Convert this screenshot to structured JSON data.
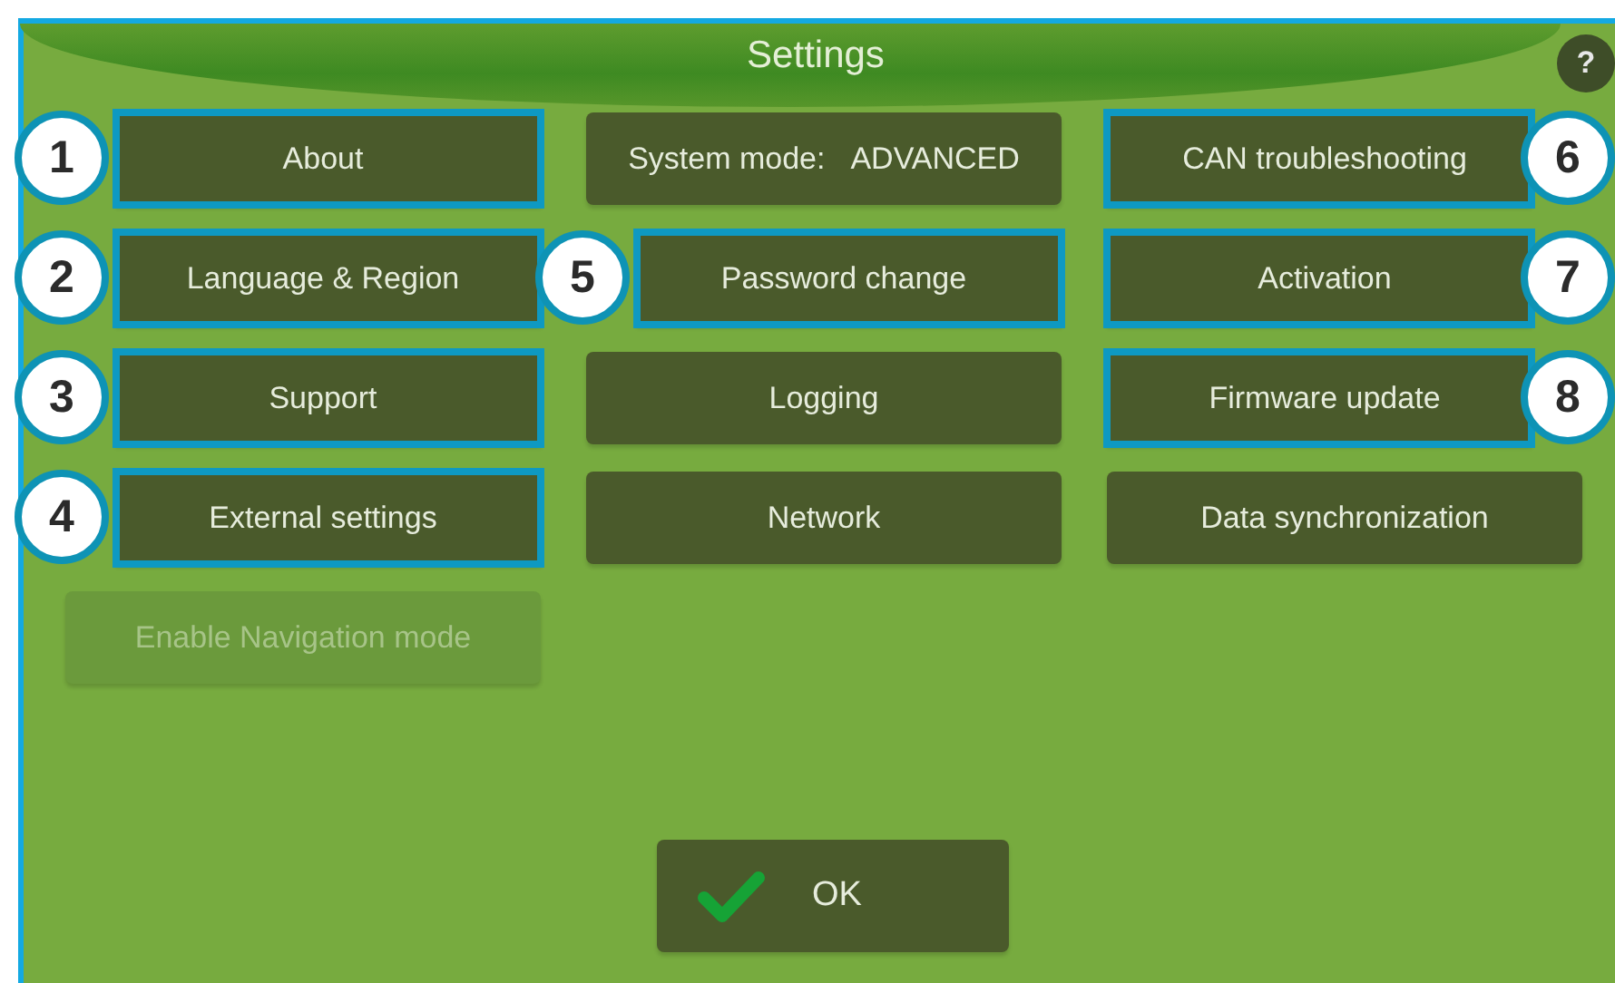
{
  "window": {
    "title": "Settings"
  },
  "help_button": "?",
  "columns": [
    {
      "buttons": [
        {
          "label": "About",
          "callout": "1",
          "disabled": false
        },
        {
          "label": "Language & Region",
          "callout": "2",
          "disabled": false
        },
        {
          "label": "Support",
          "callout": "3",
          "disabled": false
        },
        {
          "label": "External settings",
          "callout": "4",
          "disabled": false
        },
        {
          "label": "Enable Navigation mode",
          "disabled": true
        }
      ]
    },
    {
      "buttons": [
        {
          "label": "System mode:",
          "value": "ADVANCED",
          "disabled": false
        },
        {
          "label": "Password change",
          "callout": "5",
          "disabled": false
        },
        {
          "label": "Logging",
          "disabled": false
        },
        {
          "label": "Network",
          "disabled": false
        }
      ]
    },
    {
      "buttons": [
        {
          "label": "CAN troubleshooting",
          "callout": "6",
          "disabled": false
        },
        {
          "label": "Activation",
          "callout": "7",
          "disabled": false
        },
        {
          "label": "Firmware update",
          "callout": "8",
          "disabled": false
        },
        {
          "label": "Data synchronization",
          "disabled": false
        }
      ]
    }
  ],
  "ok_button": "OK"
}
